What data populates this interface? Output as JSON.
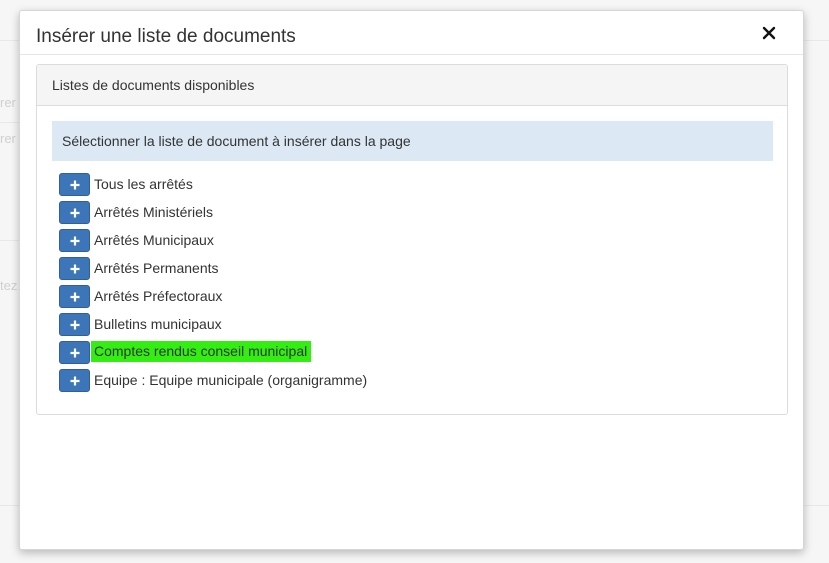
{
  "modal": {
    "title": "Insérer une liste de documents",
    "close_icon": "close-icon"
  },
  "panel": {
    "heading": "Listes de documents disponibles",
    "instruction": "Sélectionner la liste de document à insérer dans la page"
  },
  "documents": [
    {
      "label": "Tous les arrêtés",
      "highlighted": false
    },
    {
      "label": "Arrêtés Ministériels",
      "highlighted": false
    },
    {
      "label": "Arrêtés Municipaux",
      "highlighted": false
    },
    {
      "label": "Arrêtés Permanents",
      "highlighted": false
    },
    {
      "label": "Arrêtés Préfectoraux",
      "highlighted": false
    },
    {
      "label": "Bulletins municipaux",
      "highlighted": false
    },
    {
      "label": "Comptes rendus conseil municipal",
      "highlighted": true
    },
    {
      "label": "Equipe : Equipe municipale (organigramme)",
      "highlighted": false
    }
  ],
  "colors": {
    "add_button": "#3c76b8",
    "info_background": "#dce9f5",
    "highlight": "#33ee11"
  },
  "background_fragments": [
    "rer",
    "rer",
    "tez"
  ]
}
